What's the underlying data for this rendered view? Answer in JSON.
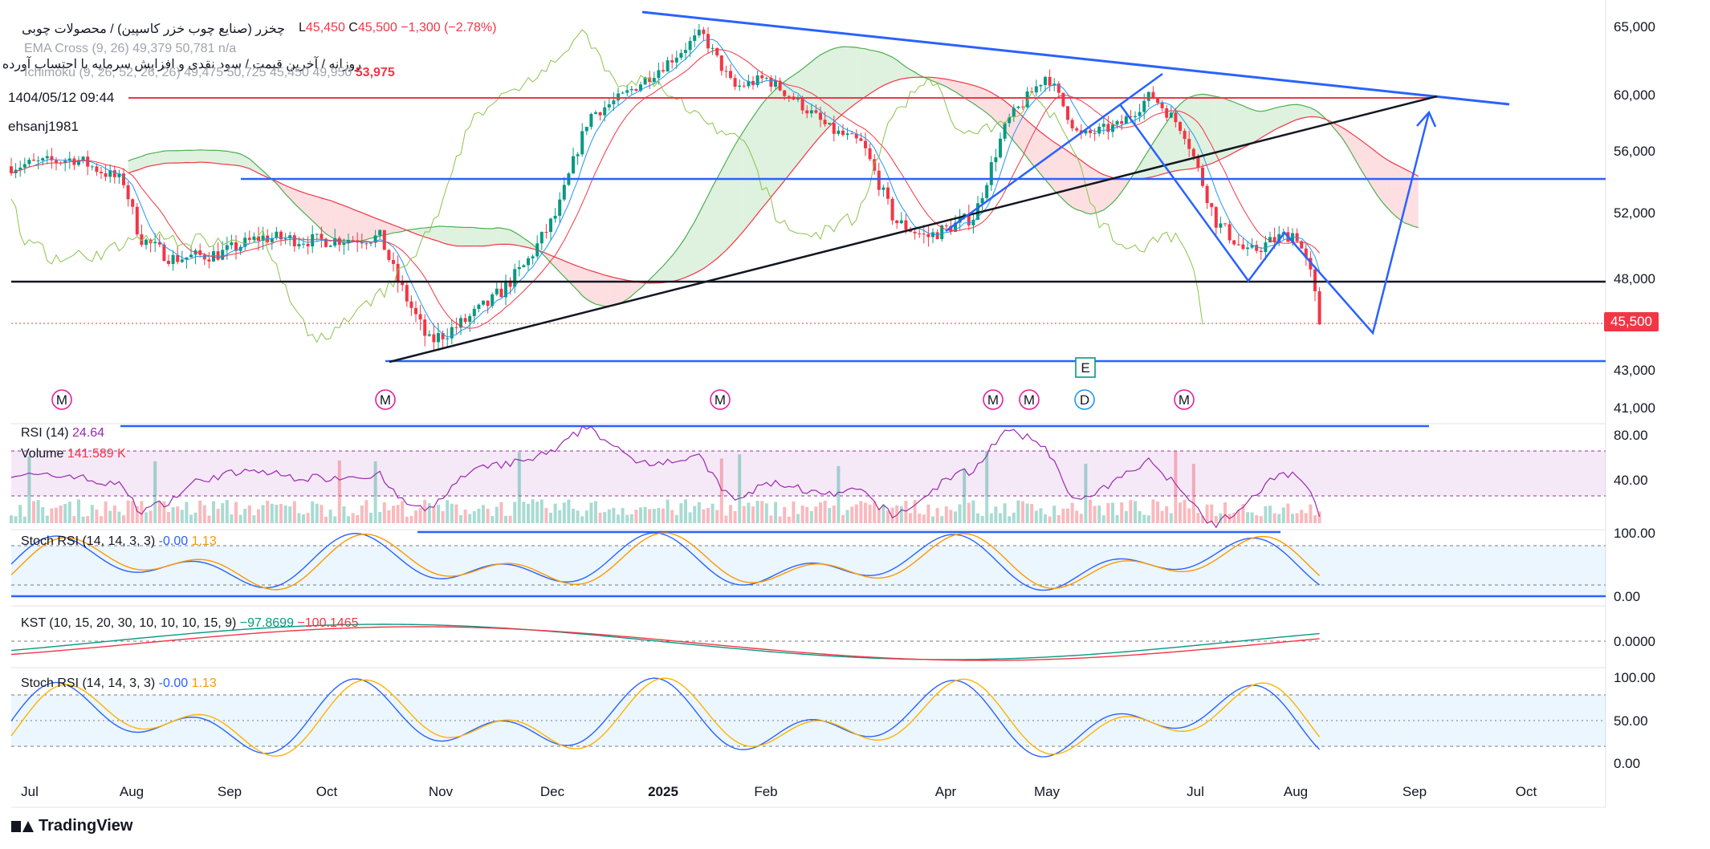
{
  "header": {
    "symbol_line": "چخزر (صنایع چوب خزر کاسپین) / محصولات چوبی",
    "low_label": "L",
    "low_value": "45,450",
    "close_label": "C",
    "close_value": "45,500",
    "change": "−1,300 (−2.78%)",
    "ema_label": "EMA Cross (9, 26)",
    "ema_values": "49,379  50,781  n/a",
    "note_line": "روزانه / آخرین قیمت / سود نقدی و افزایش سرمایه با احتساب آورده",
    "ichimoku_label": "Ichimoku (9, 26, 52, 26, 26)",
    "ichimoku_values": "49,475  50,725  45,450  49,950",
    "ichimoku_last": "53,975",
    "datetime": "1404/05/12 09:44",
    "author": "ehsanj1981"
  },
  "price_badge": "45,500",
  "price_axis": [
    "65,000",
    "60,000",
    "56,000",
    "52,000",
    "48,000",
    "43,000",
    "41,000"
  ],
  "x_axis": [
    "Jul",
    "Aug",
    "Sep",
    "Oct",
    "Nov",
    "Dec",
    "2025",
    "Feb",
    "Apr",
    "May",
    "Jul",
    "Aug",
    "Sep",
    "Oct"
  ],
  "events": [
    "M",
    "M",
    "M",
    "M",
    "M",
    "D",
    "M"
  ],
  "earnings_label": "E",
  "panes": {
    "rsi": {
      "label": "RSI (14)",
      "value": "24.64",
      "axis": [
        "80.00",
        "40.00"
      ]
    },
    "volume": {
      "label": "Volume",
      "value": "141.589 K"
    },
    "stoch1": {
      "label": "Stoch RSI (14, 14, 3, 3)",
      "k": "-0.00",
      "d": "1.13",
      "axis": [
        "100.00",
        "0.00"
      ]
    },
    "kst": {
      "label": "KST (10, 15, 20, 30, 10, 10, 10, 15, 9)",
      "v1": "−97.8699",
      "v2": "−100.1465",
      "axis": [
        "0.0000"
      ]
    },
    "stoch2": {
      "label": "Stoch RSI (14, 14, 3, 3)",
      "k": "-0.00",
      "d": "1.13",
      "axis": [
        "100.00",
        "50.00",
        "0.00"
      ]
    }
  },
  "colors": {
    "up": "#089981",
    "down": "#f23645",
    "trend": "#2962ff",
    "rsi": "#9c27b0",
    "kst1": "#089981",
    "kst2": "#f23645",
    "stochK": "#2962ff",
    "stochD": "#ff9800"
  },
  "watermark": "TradingView",
  "chart_data": {
    "type": "line",
    "title": "چخزر (صنایع چوب خزر کاسپین) / محصولات چوبی",
    "x": [
      "Jul",
      "Aug",
      "Sep",
      "Oct",
      "Nov",
      "Dec",
      "2025",
      "Feb",
      "Apr",
      "May",
      "Jul",
      "Aug"
    ],
    "series": [
      {
        "name": "Close",
        "values": [
          55000,
          49500,
          50500,
          50500,
          44500,
          59500,
          63500,
          60500,
          53000,
          57500,
          50500,
          45500
        ]
      }
    ],
    "ylim": [
      40500,
      65500
    ]
  }
}
